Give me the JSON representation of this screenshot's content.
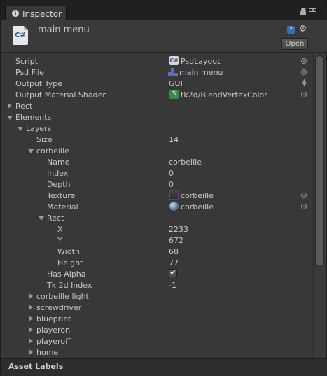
{
  "tab": {
    "label": "Inspector"
  },
  "header": {
    "title": "main menu",
    "open_label": "Open",
    "script_glyph": "C#"
  },
  "fields": {
    "script": {
      "label": "Script",
      "value": "PsdLayout",
      "icon_glyph": "C#"
    },
    "psd_file": {
      "label": "Psd File",
      "value": "main menu"
    },
    "output_type": {
      "label": "Output Type",
      "value": "GUI"
    },
    "output_shader": {
      "label": "Output Material Shader",
      "value": "tk2d/BlendVertexColor",
      "icon_glyph": "S"
    },
    "rect": {
      "label": "Rect"
    },
    "elements": {
      "label": "Elements"
    },
    "layers": {
      "label": "Layers"
    },
    "size": {
      "label": "Size",
      "value": "14"
    },
    "corbeille": {
      "label": "corbeille"
    },
    "name": {
      "label": "Name",
      "value": "corbeille"
    },
    "index": {
      "label": "Index",
      "value": "0"
    },
    "depth": {
      "label": "Depth",
      "value": "0"
    },
    "texture": {
      "label": "Texture",
      "value": "corbeille"
    },
    "material": {
      "label": "Material",
      "value": "corbeille"
    },
    "inner_rect": {
      "label": "Rect"
    },
    "x": {
      "label": "X",
      "value": "2233"
    },
    "y": {
      "label": "Y",
      "value": "672"
    },
    "width": {
      "label": "Width",
      "value": "68"
    },
    "height": {
      "label": "Height",
      "value": "77"
    },
    "has_alpha": {
      "label": "Has Alpha",
      "checked": true,
      "check_glyph": "✔"
    },
    "tk2d_index": {
      "label": "Tk 2d Index",
      "value": "-1"
    }
  },
  "layers_list": [
    "corbeille light",
    "screwdriver",
    "blueprint",
    "playeron",
    "playeroff",
    "home"
  ],
  "footer": {
    "label": "Asset Labels"
  },
  "icons": {
    "help_glyph": "?",
    "gear_glyph": "⚙",
    "window_up_glyph": "▪",
    "window_down_glyph": "▾",
    "arrow_up_glyph": "▲",
    "arrow_down_glyph": "▼"
  },
  "colors": {
    "panel": "#383838",
    "tabbar": "#202020",
    "text": "#c8c8c8"
  }
}
